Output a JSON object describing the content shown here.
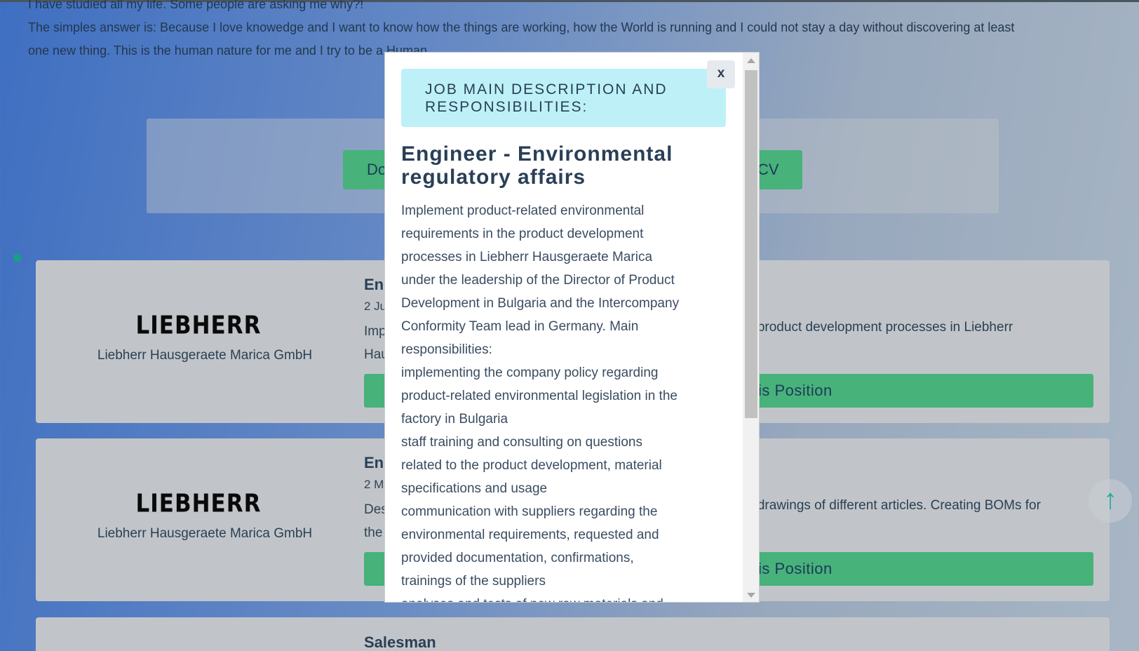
{
  "intro": {
    "line1": "I have studied all my life. Some people are asking me why?!",
    "line2": "The simples answer is: Because I love knowedge and I want to know how the things are working, how the World is running and I could not stay a day without discovering at least one new thing. This is the human nature for me and I try to be a Human."
  },
  "cv_panel": {
    "left_button": "Do",
    "right_button": "CV"
  },
  "jobs": [
    {
      "logo": "LIEBHERR",
      "company": "Liebherr Hausgeraete Marica GmbH",
      "title": "En",
      "date": "2 Ju",
      "desc_prefix": "Imp",
      "desc_tail": "e product development processes in Liebherr",
      "desc_line2": "Hau",
      "apply_label": "is Position"
    },
    {
      "logo": "LIEBHERR",
      "company": "Liebherr Hausgeraete Marica GmbH",
      "title": "En",
      "date": "2 M",
      "desc_prefix": "Des",
      "desc_tail": "d drawings of different articles. Creating BOMs for",
      "desc_line2": "the",
      "apply_label": "is Position"
    },
    {
      "title": "Salesman"
    }
  ],
  "modal": {
    "header": "JOB MAIN DESCRIPTION AND RESPONSIBILITIES:",
    "close": "x",
    "title": "Engineer - Environmental regulatory affairs",
    "body": [
      "Implement product-related environmental requirements in the product development processes in Liebherr Hausgeraete Marica under the leadership of the Director of Product Development in Bulgaria and the Intercompany Conformity Team lead in Germany. Main responsibilities:",
      "implementing the company policy regarding product-related environmental legislation in the factory in Bulgaria",
      "staff training and consulting on questions related to the product development, material specifications and usage",
      "communication with suppliers regarding the environmental requirements, requested and provided documentation, confirmations, trainings of the suppliers",
      "analyses and tests of new raw materials and"
    ]
  },
  "scroll_top_icon": "arrow-up-icon"
}
